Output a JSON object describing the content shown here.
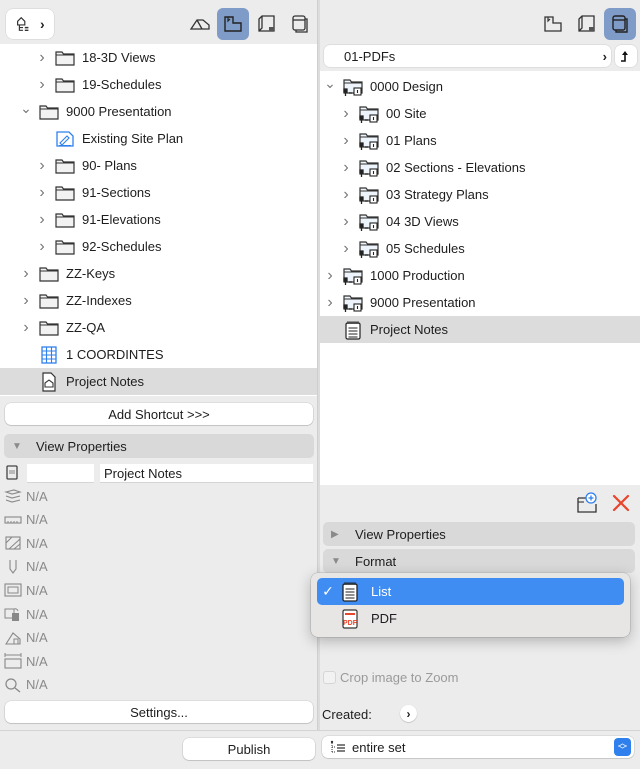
{
  "left": {
    "toolbar": {
      "nav_icon": "navigator-tree-icon",
      "views": [
        {
          "name": "project-map",
          "active": false
        },
        {
          "name": "view-map",
          "active": true
        },
        {
          "name": "layout-book",
          "active": false
        },
        {
          "name": "publisher-sets",
          "active": false
        }
      ]
    },
    "tree": [
      {
        "label": "18-3D Views",
        "type": "folder",
        "level": 2,
        "expand": "collapsed"
      },
      {
        "label": "19-Schedules",
        "type": "folder",
        "level": 2,
        "expand": "collapsed"
      },
      {
        "label": "9000 Presentation",
        "type": "folder",
        "level": 1,
        "expand": "expanded"
      },
      {
        "label": "Existing Site Plan",
        "type": "view",
        "level": 2,
        "expand": "none"
      },
      {
        "label": "90- Plans",
        "type": "folder",
        "level": 2,
        "expand": "collapsed"
      },
      {
        "label": "91-Sections",
        "type": "folder",
        "level": 2,
        "expand": "collapsed"
      },
      {
        "label": "91-Elevations",
        "type": "folder",
        "level": 2,
        "expand": "collapsed"
      },
      {
        "label": "92-Schedules",
        "type": "folder",
        "level": 2,
        "expand": "collapsed"
      },
      {
        "label": "ZZ-Keys",
        "type": "folder",
        "level": 1,
        "expand": "collapsed"
      },
      {
        "label": "ZZ-Indexes",
        "type": "folder",
        "level": 1,
        "expand": "collapsed"
      },
      {
        "label": "ZZ-QA",
        "type": "folder",
        "level": 1,
        "expand": "collapsed"
      },
      {
        "label": "1 COORDINTES",
        "type": "schedule",
        "level": 1,
        "expand": "none"
      },
      {
        "label": "Project Notes",
        "type": "notes",
        "level": 1,
        "expand": "none",
        "selected": true
      }
    ],
    "add_shortcut_label": "Add Shortcut >>>",
    "view_properties": {
      "title": "View Properties",
      "id_value": "",
      "name_value": "Project Notes",
      "rows": [
        {
          "icon": "layers-icon",
          "value": "N/A"
        },
        {
          "icon": "scale-icon",
          "value": "N/A"
        },
        {
          "icon": "structure-display-icon",
          "value": "N/A"
        },
        {
          "icon": "pen-set-icon",
          "value": "N/A"
        },
        {
          "icon": "model-view-options-icon",
          "value": "N/A"
        },
        {
          "icon": "graphic-override-icon",
          "value": "N/A"
        },
        {
          "icon": "renovation-filter-icon",
          "value": "N/A"
        },
        {
          "icon": "dimensions-icon",
          "value": "N/A"
        },
        {
          "icon": "zoom-icon",
          "value": "N/A"
        }
      ]
    },
    "settings_label": "Settings...",
    "publish_label": "Publish"
  },
  "right": {
    "toolbar": {
      "views": [
        {
          "name": "view-map",
          "active": false
        },
        {
          "name": "layout-book",
          "active": false
        },
        {
          "name": "publisher-sets",
          "active": true
        }
      ]
    },
    "path": "01-PDFs",
    "tree": [
      {
        "label": "0000 Design",
        "type": "publisher-folder",
        "level": 1,
        "expand": "expanded"
      },
      {
        "label": "00 Site",
        "type": "publisher-folder",
        "level": 2,
        "expand": "collapsed"
      },
      {
        "label": "01 Plans",
        "type": "publisher-folder",
        "level": 2,
        "expand": "collapsed"
      },
      {
        "label": "02 Sections - Elevations",
        "type": "publisher-folder",
        "level": 2,
        "expand": "collapsed"
      },
      {
        "label": "03 Strategy Plans",
        "type": "publisher-folder",
        "level": 2,
        "expand": "collapsed"
      },
      {
        "label": "04 3D Views",
        "type": "publisher-folder",
        "level": 2,
        "expand": "collapsed"
      },
      {
        "label": "05 Schedules",
        "type": "publisher-folder",
        "level": 2,
        "expand": "collapsed"
      },
      {
        "label": "1000 Production",
        "type": "publisher-folder",
        "level": 1,
        "expand": "collapsed"
      },
      {
        "label": "9000 Presentation",
        "type": "publisher-folder",
        "level": 1,
        "expand": "collapsed"
      },
      {
        "label": "Project Notes",
        "type": "list",
        "level": 1,
        "expand": "none",
        "selected": true
      }
    ],
    "view_properties_title": "View Properties",
    "format_title": "Format",
    "format_menu": {
      "options": [
        {
          "label": "List",
          "icon": "list-doc-icon",
          "selected": true
        },
        {
          "label": "PDF",
          "icon": "pdf-doc-icon",
          "selected": false
        }
      ]
    },
    "crop_label": "Crop image to Zoom",
    "crop_checked": false,
    "created_label": "Created:",
    "publish_set_select": "entire set",
    "colors": {
      "accent": "#3f8cf2",
      "delete": "#e8452c",
      "active_tab": "#7f9cc8"
    }
  }
}
